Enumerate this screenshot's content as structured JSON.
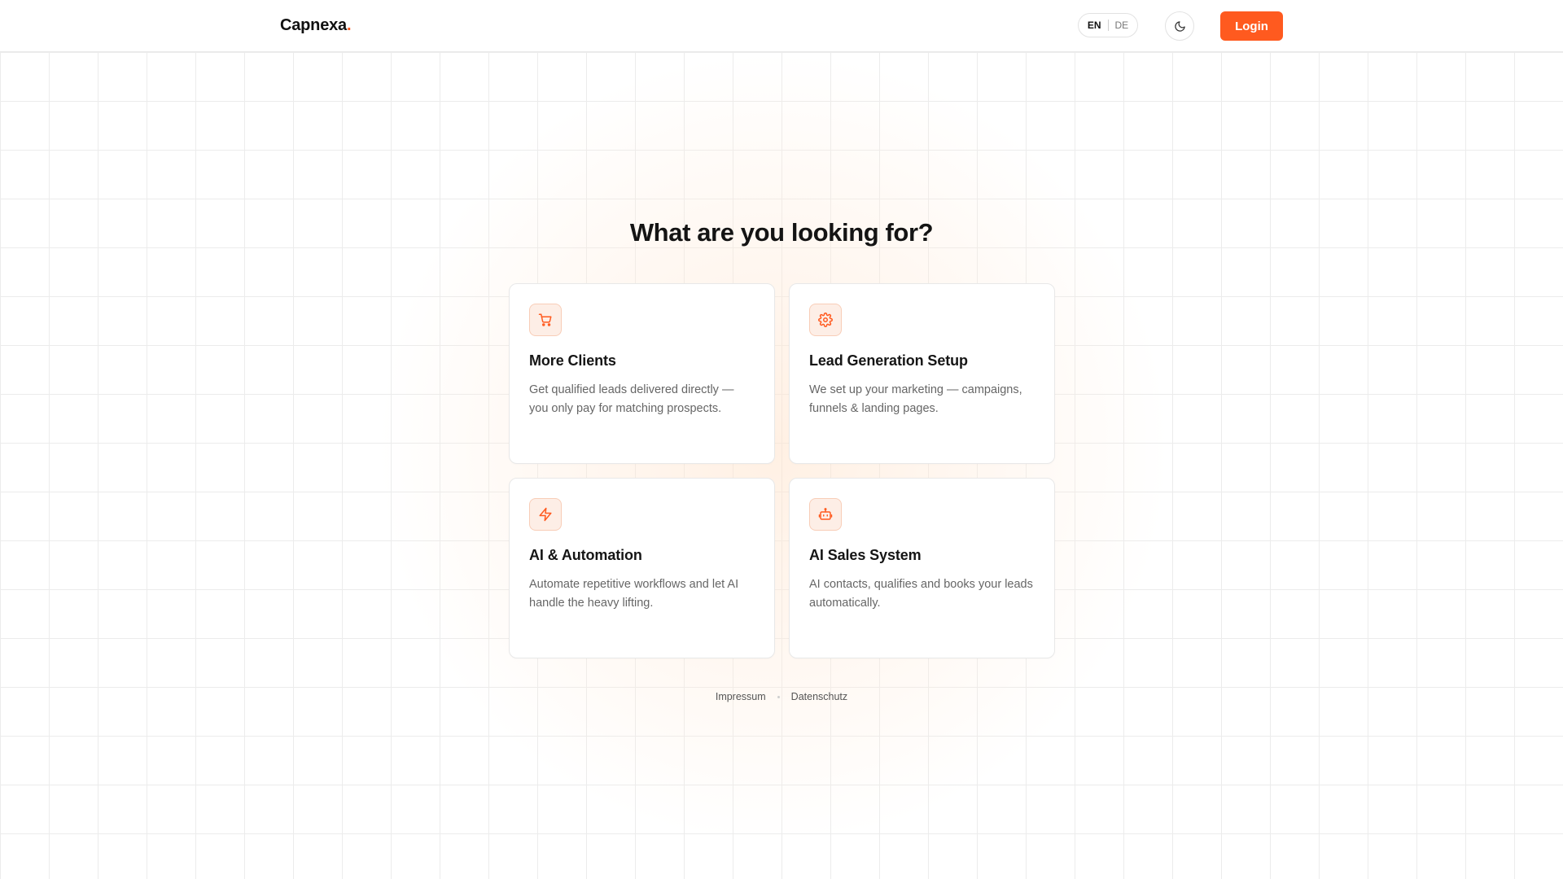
{
  "brand": {
    "name": "Capnexa",
    "dot": ".",
    "accent_color": "#ff5a1f"
  },
  "header": {
    "languages": [
      "EN",
      "DE"
    ],
    "active_language": "EN",
    "theme_icon": "moon-icon",
    "login_label": "Login"
  },
  "main": {
    "title": "What are you looking for?",
    "cards": [
      {
        "icon": "shopping-cart-icon",
        "title": "More Clients",
        "description": "Get qualified leads delivered directly — you only pay for matching prospects."
      },
      {
        "icon": "gear-icon",
        "title": "Lead Generation Setup",
        "description": "We set up your marketing — campaigns, funnels & landing pages."
      },
      {
        "icon": "lightning-bolt-icon",
        "title": "AI & Automation",
        "description": "Automate repetitive workflows and let AI handle the heavy lifting."
      },
      {
        "icon": "robot-icon",
        "title": "AI Sales System",
        "description": "AI contacts, qualifies and books your leads automatically."
      }
    ]
  },
  "footer": {
    "links": [
      "Impressum",
      "Datenschutz"
    ]
  }
}
